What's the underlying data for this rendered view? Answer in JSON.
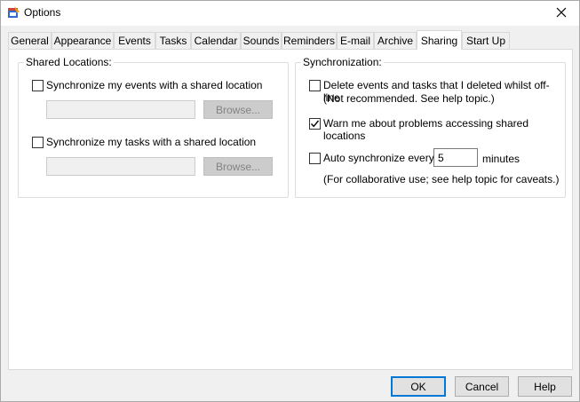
{
  "window": {
    "title": "Options",
    "icon": "app-icon",
    "close_icon": "close-icon"
  },
  "tabs": [
    {
      "label": "General"
    },
    {
      "label": "Appearance"
    },
    {
      "label": "Events"
    },
    {
      "label": "Tasks"
    },
    {
      "label": "Calendar"
    },
    {
      "label": "Sounds"
    },
    {
      "label": "Reminders"
    },
    {
      "label": "E-mail"
    },
    {
      "label": "Archive"
    },
    {
      "label": "Sharing",
      "active": true
    },
    {
      "label": "Start Up"
    }
  ],
  "shared_locations": {
    "title": "Shared Locations:",
    "events_checkbox": {
      "label": "Synchronize my events with a shared location",
      "checked": false
    },
    "events_path": "",
    "events_browse": "Browse...",
    "tasks_checkbox": {
      "label": "Synchronize my tasks with a shared location",
      "checked": false
    },
    "tasks_path": "",
    "tasks_browse": "Browse..."
  },
  "synchronization": {
    "title": "Synchronization:",
    "delete_checkbox": {
      "label": "Delete events and tasks that I deleted whilst off-line",
      "note": "(Not recommended. See help topic.)",
      "checked": false
    },
    "warn_checkbox": {
      "label": "Warn me about problems accessing shared locations",
      "checked": true
    },
    "auto_checkbox": {
      "label": "Auto synchronize every",
      "checked": false
    },
    "auto_minutes_value": "5",
    "minutes_label": "minutes",
    "auto_note": "(For collaborative use; see help topic for caveats.)"
  },
  "buttons": {
    "ok": "OK",
    "cancel": "Cancel",
    "help": "Help"
  }
}
